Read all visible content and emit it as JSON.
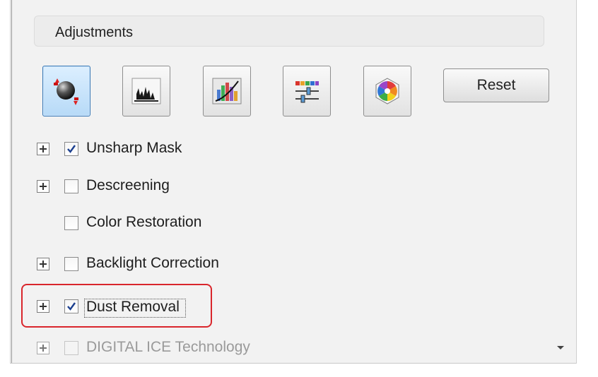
{
  "section": {
    "title": "Adjustments"
  },
  "toolbar": {
    "icons": [
      {
        "name": "auto-exposure-icon",
        "active": true
      },
      {
        "name": "histogram-adjustment-icon",
        "active": false
      },
      {
        "name": "tone-correction-icon",
        "active": false
      },
      {
        "name": "image-adjustment-icon",
        "active": false
      },
      {
        "name": "color-palette-icon",
        "active": false
      }
    ],
    "reset_label": "Reset"
  },
  "options": [
    {
      "label": "Unsharp Mask",
      "checked": true,
      "expandable": true,
      "enabled": true
    },
    {
      "label": "Descreening",
      "checked": false,
      "expandable": true,
      "enabled": true
    },
    {
      "label": "Color Restoration",
      "checked": false,
      "expandable": false,
      "enabled": true
    },
    {
      "label": "Backlight Correction",
      "checked": false,
      "expandable": true,
      "enabled": true
    },
    {
      "label": "Dust Removal",
      "checked": true,
      "expandable": true,
      "enabled": true,
      "highlighted": true
    },
    {
      "label": "DIGITAL ICE Technology",
      "checked": false,
      "expandable": true,
      "enabled": false
    }
  ],
  "colors": {
    "highlight": "#d9262c",
    "active_button": "#b7daf7"
  }
}
